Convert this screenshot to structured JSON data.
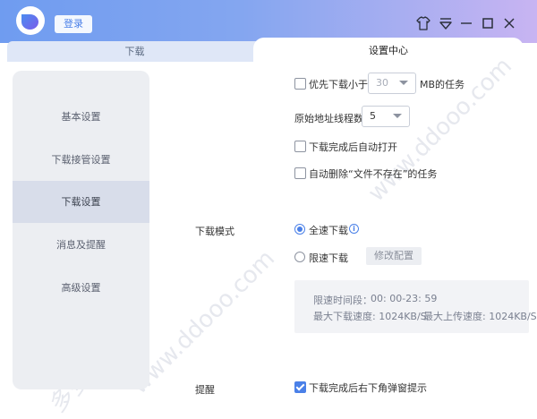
{
  "header": {
    "login_label": "登录"
  },
  "tabs": {
    "download": "下载",
    "settings": "设置中心"
  },
  "sidebar": {
    "items": [
      {
        "label": "基本设置"
      },
      {
        "label": "下载接管设置"
      },
      {
        "label": "下载设置"
      },
      {
        "label": "消息及提醒"
      },
      {
        "label": "高级设置"
      }
    ],
    "active_index": 2
  },
  "settings": {
    "priority_small": {
      "prefix": "优先下载小于",
      "value": "30",
      "suffix": "MB的任务",
      "checked": false
    },
    "threads": {
      "label": "原始地址线程数",
      "value": "5"
    },
    "auto_open": {
      "label": "下载完成后自动打开",
      "checked": false
    },
    "auto_delete": {
      "label": "自动删除“文件不存在”的任务",
      "checked": false
    },
    "download_mode": {
      "section_label": "下载模式",
      "full_speed": {
        "label": "全速下载",
        "checked": true
      },
      "limited": {
        "label": "限速下载",
        "checked": false
      },
      "config_button": "修改配置"
    },
    "speed_limits": {
      "time_label": "限速时间段：",
      "time_value": "00: 00-23: 59",
      "max_download": "最大下载速度: 1024KB/S",
      "max_upload": "最大上传速度: 1024KB/S"
    },
    "reminder": {
      "section_label": "提醒",
      "popup": {
        "label": "下载完成后右下角弹窗提示",
        "checked": true
      }
    }
  },
  "watermark": {
    "text_a": "多多软件站",
    "text_b": "www.ddooo.com"
  },
  "colors": {
    "accent": "#4a80e8",
    "titlebar_start": "#6f9cf0",
    "titlebar_end": "#c8b4f2",
    "nav_bg": "#eceef2",
    "nav_active": "#d8ddea"
  }
}
